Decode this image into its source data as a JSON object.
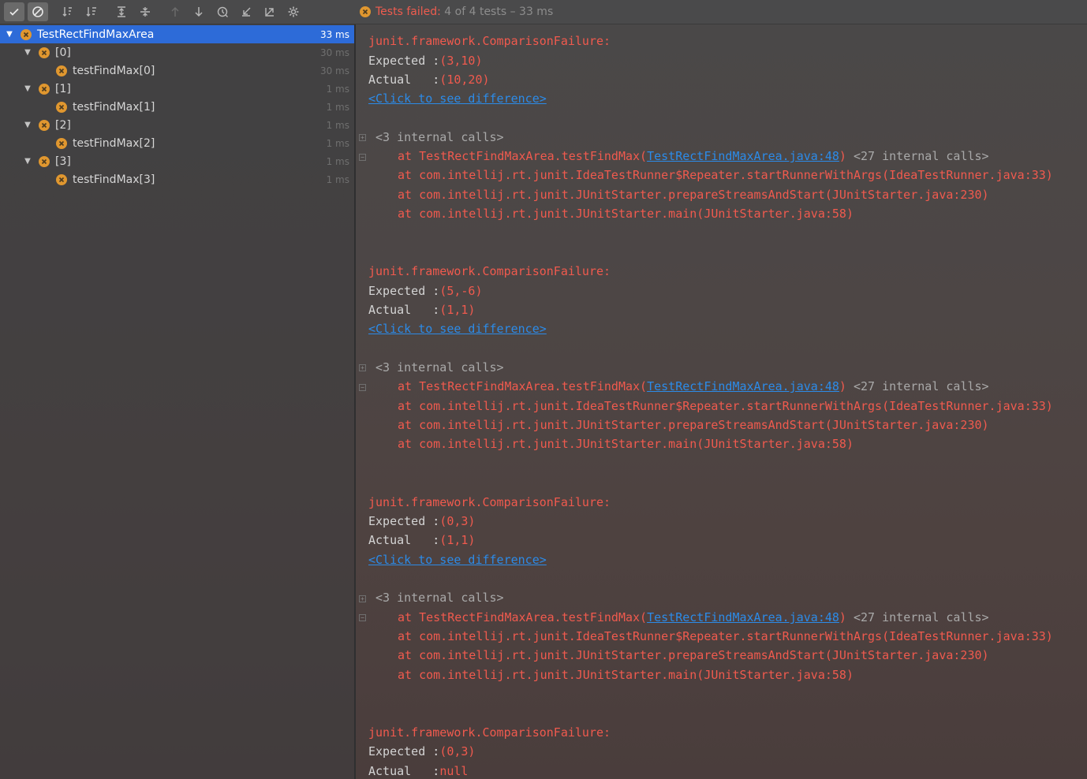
{
  "toolbar": {
    "buttons": [
      {
        "name": "show-passed",
        "icon": "check-icon"
      },
      {
        "name": "show-ignored",
        "icon": "ban-icon"
      },
      {
        "name": "sort-alpha",
        "icon": "sort-alpha-icon"
      },
      {
        "name": "sort-duration",
        "icon": "sort-duration-icon"
      },
      {
        "name": "expand-all",
        "icon": "expand-all-icon"
      },
      {
        "name": "collapse-all",
        "icon": "collapse-all-icon"
      },
      {
        "name": "prev-failed",
        "icon": "arrow-up-icon"
      },
      {
        "name": "next-failed",
        "icon": "arrow-down-icon"
      },
      {
        "name": "test-history",
        "icon": "history-icon"
      },
      {
        "name": "import-tests",
        "icon": "import-icon"
      },
      {
        "name": "export-tests",
        "icon": "export-icon"
      },
      {
        "name": "settings",
        "icon": "gear-icon"
      }
    ]
  },
  "status": {
    "prefix": "Tests failed: ",
    "failed": "4",
    "suffix": " of 4 tests – 33 ms"
  },
  "tree": {
    "root": {
      "label": "TestRectFindMaxArea",
      "time": "33 ms"
    },
    "items": [
      {
        "label": "[0]",
        "time": "30 ms",
        "child": {
          "label": "testFindMax[0]",
          "time": "30 ms"
        }
      },
      {
        "label": "[1]",
        "time": "1 ms",
        "child": {
          "label": "testFindMax[1]",
          "time": "1 ms"
        }
      },
      {
        "label": "[2]",
        "time": "1 ms",
        "child": {
          "label": "testFindMax[2]",
          "time": "1 ms"
        }
      },
      {
        "label": "[3]",
        "time": "1 ms",
        "child": {
          "label": "testFindMax[3]",
          "time": "1 ms"
        }
      }
    ]
  },
  "console": {
    "failure_label": "junit.framework.ComparisonFailure:",
    "expected_label": "Expected :",
    "actual_label": "Actual   :",
    "diff_link": "<Click to see difference>",
    "internal_calls_3": "<3 internal calls>",
    "at_prefix": "at ",
    "frame1_method": "TestRectFindMaxArea.testFindMax(",
    "frame1_link": "TestRectFindMaxArea.java:48",
    "frame1_tail": ")",
    "internal_calls_27": " <27 internal calls>",
    "frame2": "at com.intellij.rt.junit.IdeaTestRunner$Repeater.startRunnerWithArgs(IdeaTestRunner.java:33)",
    "frame3": "at com.intellij.rt.junit.JUnitStarter.prepareStreamsAndStart(JUnitStarter.java:230)",
    "frame4": "at com.intellij.rt.junit.JUnitStarter.main(JUnitStarter.java:58)",
    "failures": [
      {
        "expected": "(3,10)",
        "actual": "(10,20)"
      },
      {
        "expected": "(5,-6)",
        "actual": "(1,1)"
      },
      {
        "expected": "(0,3)",
        "actual": "(1,1)"
      },
      {
        "expected": "(0,3)",
        "actual": "null"
      }
    ]
  },
  "colors": {
    "accent": "#2d6bd8",
    "error": "#f05a4e",
    "warning": "#e0972f",
    "link": "#2c8be8"
  }
}
